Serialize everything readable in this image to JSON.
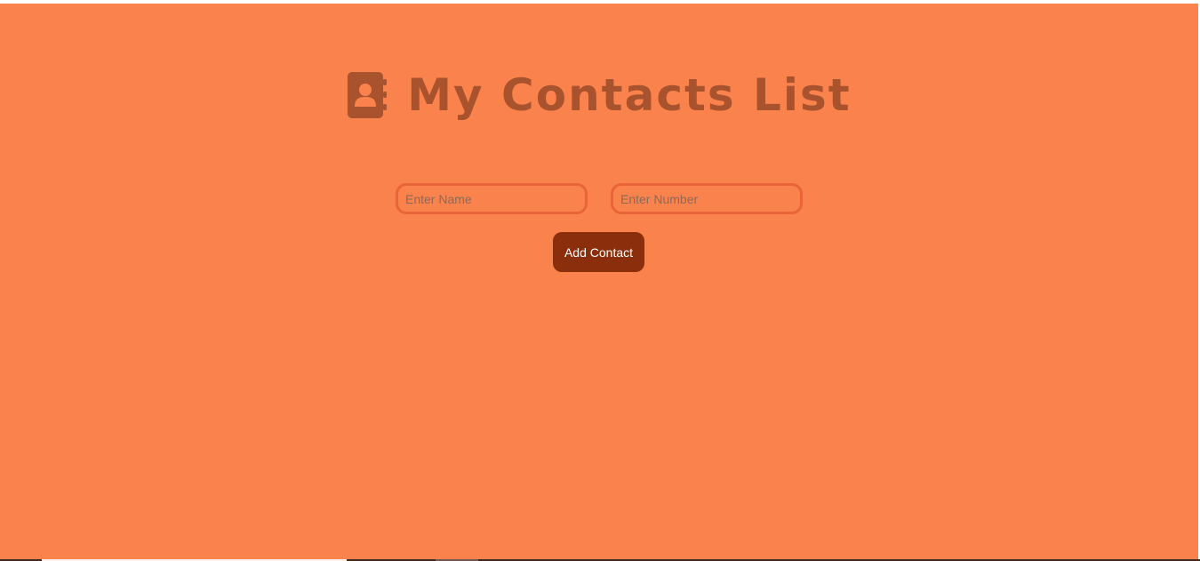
{
  "header": {
    "icon": "address-book-icon",
    "title": "My Contacts List"
  },
  "form": {
    "name_placeholder": "Enter Name",
    "name_value": "",
    "number_placeholder": "Enter Number",
    "number_value": "",
    "add_button_label": "Add Contact"
  },
  "colors": {
    "background": "#fa824c",
    "title": "#a8532e",
    "input_border": "#e8653a",
    "button": "#8a2e0c",
    "button_text": "#ffffff"
  }
}
